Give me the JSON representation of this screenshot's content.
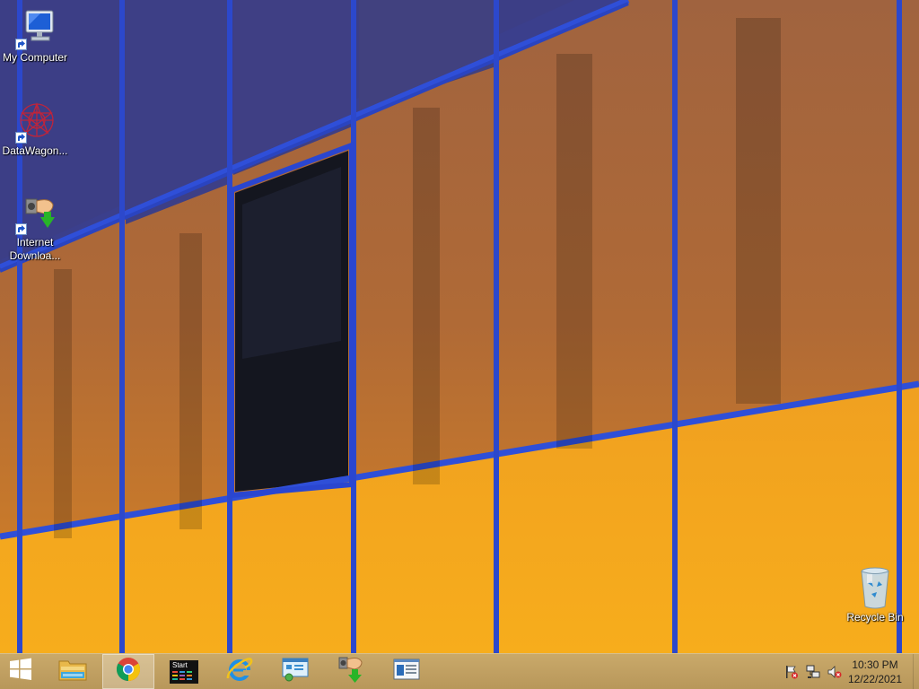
{
  "desktop": {
    "icons": [
      {
        "label": "My Computer",
        "icon": "computer-icon"
      },
      {
        "label": "DataWagon...",
        "icon": "datawagon-icon"
      },
      {
        "label": "Internet\nDownloa...",
        "icon": "internet-download-manager-icon"
      },
      {
        "label": "Recycle Bin",
        "icon": "recycle-bin-icon"
      }
    ]
  },
  "taskbar": {
    "start_icon": "windows-logo-icon",
    "pinned": [
      {
        "icon": "file-explorer-icon",
        "active": false
      },
      {
        "icon": "chrome-icon",
        "active": true
      },
      {
        "icon": "start-menu-app-icon",
        "label": "Start",
        "active": false
      },
      {
        "icon": "internet-explorer-icon",
        "active": false
      },
      {
        "icon": "network-settings-icon",
        "active": false
      },
      {
        "icon": "internet-download-manager-icon",
        "active": false
      },
      {
        "icon": "news-window-icon",
        "active": false
      }
    ],
    "tray": [
      "action-center-flag-icon",
      "network-icon",
      "volume-muted-icon"
    ],
    "clock": {
      "time": "10:30 PM",
      "date": "12/22/2021"
    }
  },
  "colors": {
    "taskbar": "#c2a263",
    "frame_blue": "#2b4bd0",
    "glass_orange": "#f2a21a",
    "glass_dim": "#9a5a3a"
  }
}
